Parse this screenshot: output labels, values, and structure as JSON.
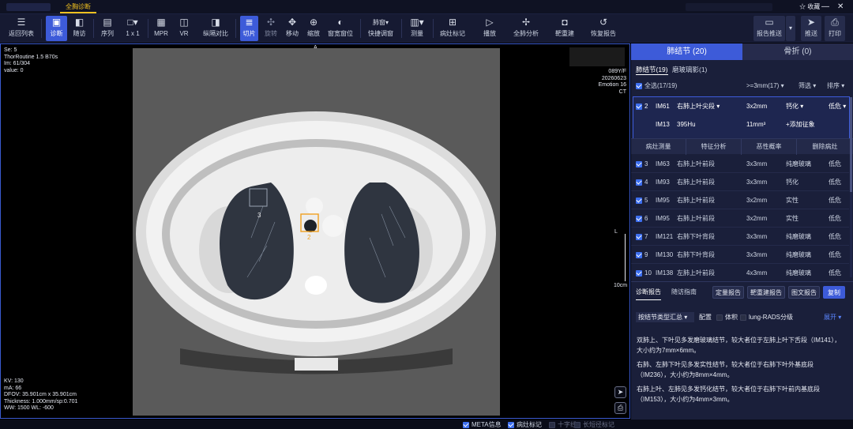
{
  "topbar": {
    "active_tab": "全胸诊断",
    "fav_label": "收藏",
    "fav_icon": "star-icon"
  },
  "toolbar": {
    "items": [
      {
        "label": "返回列表",
        "icon": "list-back-icon"
      },
      {
        "label": "诊断",
        "icon": "diagnose-icon"
      },
      {
        "label": "随访",
        "icon": "followup-icon"
      },
      {
        "label": "序列",
        "icon": "series-icon"
      },
      {
        "label": "1 x 1",
        "icon": "layout-icon"
      },
      {
        "label": "MPR",
        "icon": "mpr-icon"
      },
      {
        "label": "VR",
        "icon": "vr-icon"
      },
      {
        "label": "纵隔对比",
        "icon": "compare-icon"
      },
      {
        "label": "切片",
        "icon": "slice-icon"
      },
      {
        "label": "旋转",
        "icon": "rotate-icon"
      },
      {
        "label": "移动",
        "icon": "move-icon"
      },
      {
        "label": "缩放",
        "icon": "zoom-icon"
      },
      {
        "label": "窗宽窗位",
        "icon": "window-icon"
      },
      {
        "label": "快捷调窗",
        "icon": "quick-window-icon",
        "value": "肺窗"
      },
      {
        "label": "测量",
        "icon": "measure-icon"
      },
      {
        "label": "病灶标记",
        "icon": "mark-icon"
      },
      {
        "label": "播放",
        "icon": "play-icon"
      },
      {
        "label": "全肺分析",
        "icon": "lung-analysis-icon"
      },
      {
        "label": "靶重建",
        "icon": "target-icon"
      },
      {
        "label": "恢复报告",
        "icon": "restore-icon"
      },
      {
        "label": "报告推送",
        "icon": "report-push-icon"
      },
      {
        "label": "推送",
        "icon": "send-icon"
      },
      {
        "label": "打印",
        "icon": "print-icon"
      }
    ]
  },
  "viewer": {
    "top_left": [
      "Se: 5",
      "ThorRoutine  1.5  B70s",
      "Im: 61/304",
      "value: 0"
    ],
    "top_right": [
      "089Y/F",
      "20260623",
      "Emotion 16",
      "CT"
    ],
    "bottom_left": [
      "KV: 130",
      "mA: 66",
      "DFOV: 35.901cm x 35.901cm",
      "Thickness: 1.000mm/sp:0.701",
      "WW: 1500    WL: -600"
    ],
    "orient_top": "A",
    "orient_right": "L",
    "scale_label": "10cm",
    "roi_labels": [
      "3",
      "2"
    ]
  },
  "statusbar": [
    {
      "label": "META信息",
      "checked": true
    },
    {
      "label": "病灶标记",
      "checked": true
    },
    {
      "label": "十字线",
      "checked": false
    },
    {
      "label": "长短径标记",
      "checked": false
    }
  ],
  "panel": {
    "tabs": [
      "肺结节 (20)",
      "骨折 (0)"
    ],
    "subtabs": [
      "肺结节(19)",
      "磨玻璃影(1)"
    ],
    "select_all": "全选(17/19)",
    "filter_size": ">=3mm(17)",
    "filter_label": "筛选",
    "sort_label": "排序",
    "selected": {
      "num": "2",
      "im": "IM61",
      "location": "右肺上叶尖段",
      "size": "3x2mm",
      "type": "钙化",
      "risk": "低危",
      "im2": "IM13",
      "hu": "395Hu",
      "volume": "11mm³",
      "add": "+添加征象"
    },
    "actions": [
      "病灶测量",
      "特征分析",
      "恶性概率",
      "删除病灶"
    ],
    "nodules": [
      {
        "num": "3",
        "im": "IM63",
        "location": "右肺上叶前段",
        "size": "3x3mm",
        "type": "纯磨玻璃",
        "risk": "低危"
      },
      {
        "num": "4",
        "im": "IM93",
        "location": "右肺上叶前段",
        "size": "3x3mm",
        "type": "钙化",
        "risk": "低危"
      },
      {
        "num": "5",
        "im": "IM95",
        "location": "右肺上叶前段",
        "size": "3x2mm",
        "type": "实性",
        "risk": "低危"
      },
      {
        "num": "6",
        "im": "IM95",
        "location": "右肺上叶前段",
        "size": "3x2mm",
        "type": "实性",
        "risk": "低危"
      },
      {
        "num": "7",
        "im": "IM121",
        "location": "右肺下叶背段",
        "size": "3x3mm",
        "type": "纯磨玻璃",
        "risk": "低危"
      },
      {
        "num": "9",
        "im": "IM130",
        "location": "右肺下叶背段",
        "size": "3x3mm",
        "type": "纯磨玻璃",
        "risk": "低危"
      },
      {
        "num": "10",
        "im": "IM138",
        "location": "左肺上叶前段",
        "size": "4x3mm",
        "type": "纯磨玻璃",
        "risk": "低危"
      }
    ],
    "report_tabs": [
      "诊断报告",
      "随访指南"
    ],
    "report_buttons": [
      "定量报告",
      "靶重建报告",
      "图文报告",
      "复制"
    ],
    "summary_select": "按结节类型汇总",
    "config_label": "配置",
    "volume_label": "体积",
    "grading_label": "lung-RADS分级",
    "expand_label": "展开",
    "paragraphs": [
      "双肺上、下叶见多发磨玻璃结节，较大者位于左肺上叶下舌段（IM141），大小约为7mm×6mm。",
      "右肺、左肺下叶见多发实性结节，较大者位于右肺下叶外基底段（IM236），大小约为8mm×4mm。",
      "右肺上叶、左肺见多发钙化结节，较大者位于右肺下叶前内基底段（IM153），大小约为4mm×3mm。"
    ],
    "colors": {
      "accent": "#3d5bd9",
      "highlight": "#f0c020",
      "panel_bg": "#1a1f3a"
    }
  }
}
